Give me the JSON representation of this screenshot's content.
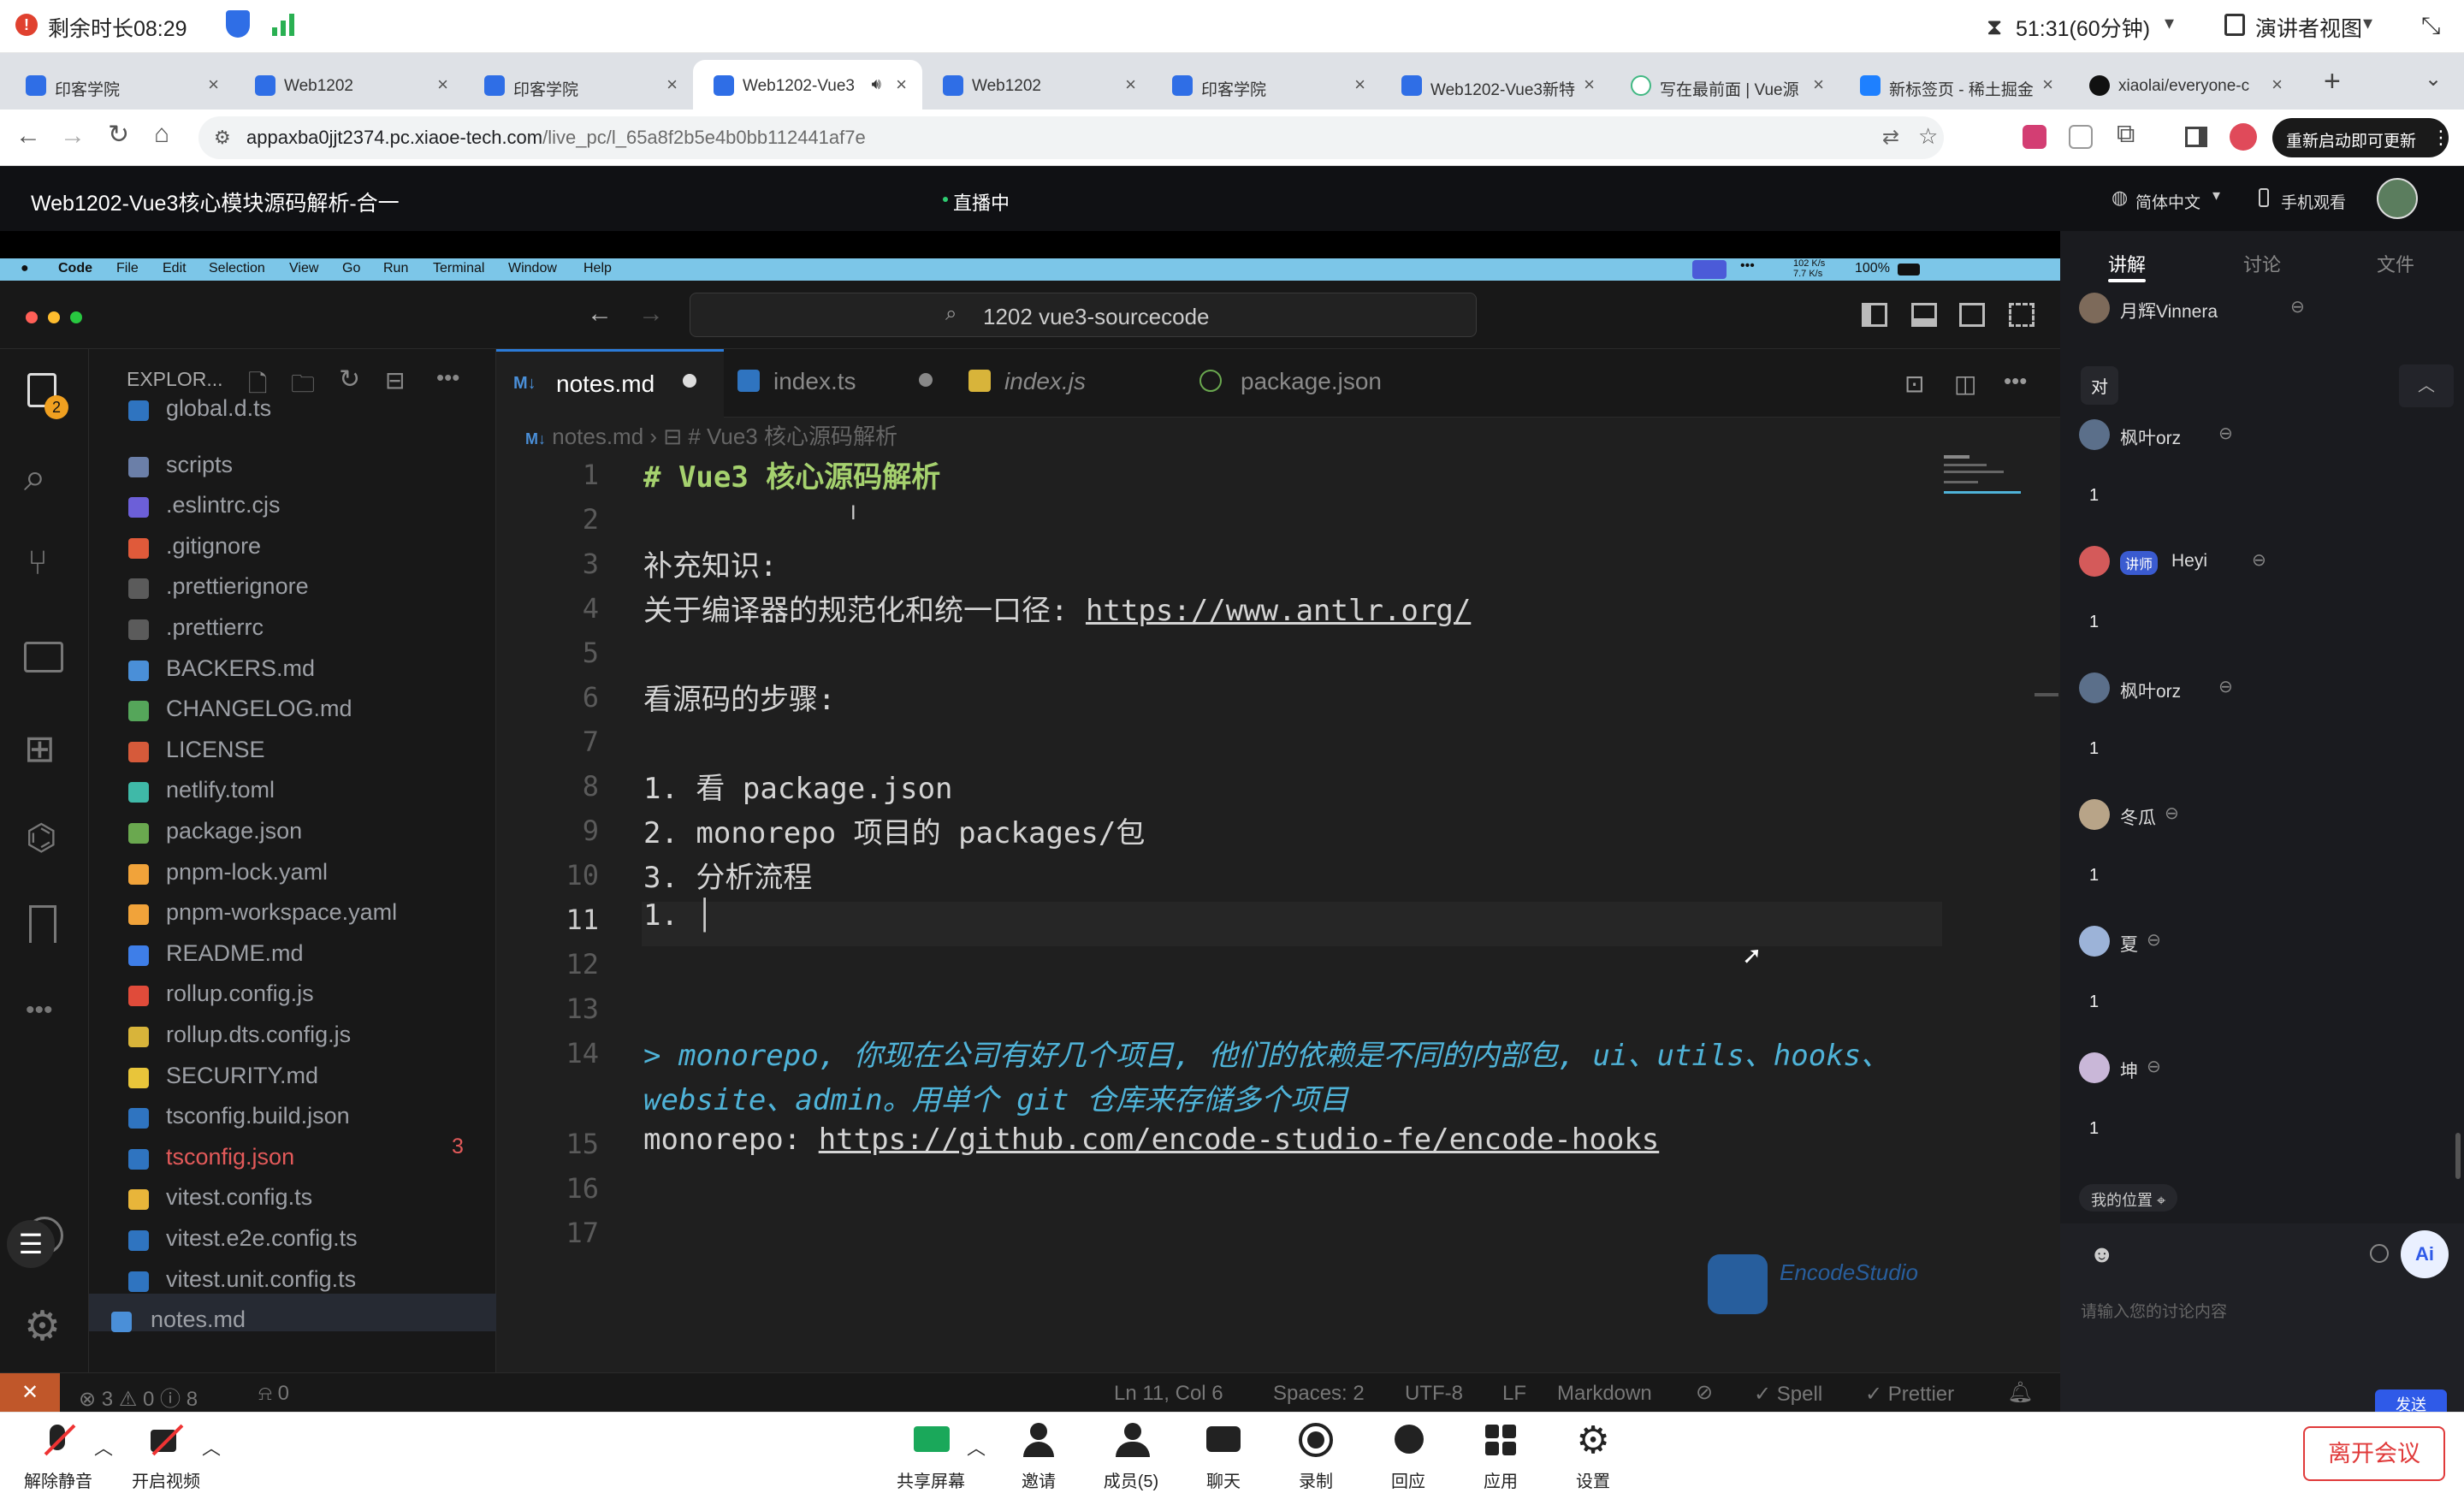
{
  "sysbar": {
    "timer_label": "剩余时长08:29",
    "duration": "51:31(60分钟)",
    "presenter_view": "演讲者视图"
  },
  "browser_tabs": [
    {
      "label": "印客学院",
      "active": false
    },
    {
      "label": "Web1202",
      "active": false
    },
    {
      "label": "印客学院",
      "active": false
    },
    {
      "label": "Web1202-Vue3",
      "active": true
    },
    {
      "label": "Web1202",
      "active": false
    },
    {
      "label": "印客学院",
      "active": false
    },
    {
      "label": "Web1202-Vue3新特",
      "active": false
    },
    {
      "label": "写在最前面 | Vue源",
      "active": false
    },
    {
      "label": "新标签页 - 稀土掘金",
      "active": false
    },
    {
      "label": "xiaolai/everyone-c",
      "active": false
    }
  ],
  "address": {
    "host": "appaxba0jjt2374.pc.xiaoe-tech.com",
    "path": "/live_pc/l_65a8f2b5e4b0bb112441af7e",
    "update_label": "重新启动即可更新"
  },
  "meeting": {
    "title": "Web1202-Vue3核心模块源码解析-合一",
    "status": "直播中",
    "language": "简体中文",
    "mobile": "手机观看"
  },
  "mac_menu": [
    "Code",
    "File",
    "Edit",
    "Selection",
    "View",
    "Go",
    "Run",
    "Terminal",
    "Window",
    "Help"
  ],
  "mac_status": {
    "net_up": "102 K/s",
    "net_down": "7.7 K/s",
    "battery": "100%"
  },
  "vscode": {
    "search": "1202 vue3-sourcecode",
    "explorer_title": "EXPLOR...",
    "activity_badge": "2",
    "files": [
      {
        "name": "global.d.ts",
        "color": "#9da0a6",
        "icon": "#2f74c0"
      },
      {
        "name": "scripts",
        "color": "#9da0a6",
        "icon": "#6b7fa8"
      },
      {
        "name": ".eslintrc.cjs",
        "color": "#9da0a6",
        "icon": "#6c5fd8"
      },
      {
        "name": ".gitignore",
        "color": "#9da0a6",
        "icon": "#e05a3a"
      },
      {
        "name": ".prettierignore",
        "color": "#9da0a6",
        "icon": "#5b5b5b"
      },
      {
        "name": ".prettierrc",
        "color": "#9da0a6",
        "icon": "#5b5b5b"
      },
      {
        "name": "BACKERS.md",
        "color": "#9da0a6",
        "icon": "#4a8fd8"
      },
      {
        "name": "CHANGELOG.md",
        "color": "#9da0a6",
        "icon": "#55a65a"
      },
      {
        "name": "LICENSE",
        "color": "#9da0a6",
        "icon": "#d65a3a"
      },
      {
        "name": "netlify.toml",
        "color": "#9da0a6",
        "icon": "#3fb9a8"
      },
      {
        "name": "package.json",
        "color": "#9da0a6",
        "icon": "#6aa84f"
      },
      {
        "name": "pnpm-lock.yaml",
        "color": "#9da0a6",
        "icon": "#f1a33a"
      },
      {
        "name": "pnpm-workspace.yaml",
        "color": "#9da0a6",
        "icon": "#f1a33a"
      },
      {
        "name": "README.md",
        "color": "#9da0a6",
        "icon": "#3e7ee8"
      },
      {
        "name": "rollup.config.js",
        "color": "#9da0a6",
        "icon": "#e04b3a"
      },
      {
        "name": "rollup.dts.config.js",
        "color": "#9da0a6",
        "icon": "#d8b43a"
      },
      {
        "name": "SECURITY.md",
        "color": "#9da0a6",
        "icon": "#e8c53a"
      },
      {
        "name": "tsconfig.build.json",
        "color": "#9da0a6",
        "icon": "#2f74c0"
      },
      {
        "name": "tsconfig.json",
        "color": "#e35a5a",
        "icon": "#2f74c0"
      },
      {
        "name": "vitest.config.ts",
        "color": "#9da0a6",
        "icon": "#e8b53a"
      },
      {
        "name": "vitest.e2e.config.ts",
        "color": "#9da0a6",
        "icon": "#2f74c0"
      },
      {
        "name": "vitest.unit.config.ts",
        "color": "#9da0a6",
        "icon": "#2f74c0"
      },
      {
        "name": "notes.md",
        "color": "#9da0a6",
        "icon": "#4a8fd8"
      }
    ],
    "tsconfig_errors": "3",
    "tabs": [
      "notes.md",
      "index.ts",
      "index.js",
      "package.json"
    ],
    "breadcrumb": [
      "notes.md",
      "# Vue3 核心源码解析"
    ],
    "lines": [
      {
        "n": "1",
        "text": "# Vue3 核心源码解析",
        "color": "#a5d16e"
      },
      {
        "n": "2",
        "text": "",
        "color": "#d4d4d4"
      },
      {
        "n": "3",
        "text": "补充知识:",
        "color": "#d4d4d4"
      },
      {
        "n": "4",
        "text": "关于编译器的规范化和统一口径: ",
        "color": "#d4d4d4",
        "link": "https://www.antlr.org/"
      },
      {
        "n": "5",
        "text": "",
        "color": "#d4d4d4"
      },
      {
        "n": "6",
        "text": "看源码的步骤:",
        "color": "#d4d4d4"
      },
      {
        "n": "7",
        "text": "",
        "color": "#d4d4d4"
      },
      {
        "n": "8",
        "text": "1. 看 package.json",
        "color": "#d4d4d4"
      },
      {
        "n": "9",
        "text": "2. monorepo 项目的 packages/包",
        "color": "#d4d4d4"
      },
      {
        "n": "10",
        "text": "3. 分析流程",
        "color": "#d4d4d4"
      },
      {
        "n": "11",
        "text": "  1. ",
        "color": "#d4d4d4"
      },
      {
        "n": "12",
        "text": "",
        "color": "#d4d4d4"
      },
      {
        "n": "13",
        "text": "",
        "color": "#d4d4d4"
      },
      {
        "n": "14",
        "text": "> monorepo, 你现在公司有好几个项目, 他们的依赖是不同的内部包, ui、utils、hooks、",
        "color": "#4fb3d8",
        "italic": true
      },
      {
        "n": "",
        "text": "website、admin。用单个 git 仓库来存储多个项目",
        "color": "#4fb3d8",
        "italic": true
      },
      {
        "n": "15",
        "text": "monorepo: ",
        "color": "#d4d4d4",
        "link": "https://github.com/encode-studio-fe/encode-hooks"
      },
      {
        "n": "16",
        "text": "",
        "color": "#d4d4d4"
      },
      {
        "n": "17",
        "text": "",
        "color": "#d4d4d4"
      }
    ],
    "watermark": "EncodeStudio",
    "status": {
      "errors": "3",
      "warnings": "0",
      "info": "8",
      "ports": "0",
      "position": "Ln 11, Col 6",
      "spaces": "Spaces: 2",
      "encoding": "UTF-8",
      "eol": "LF",
      "language": "Markdown",
      "spell": "Spell",
      "prettier": "Prettier"
    }
  },
  "chat": {
    "tabs": [
      "讲解",
      "讨论",
      "文件"
    ],
    "messages": [
      {
        "user": "月辉Vinnera",
        "text": "对"
      },
      {
        "user": "枫叶orz",
        "text": "1"
      },
      {
        "user": "Heyi",
        "badge": "讲师",
        "text": "1"
      },
      {
        "user": "枫叶orz",
        "text": "1"
      },
      {
        "user": "冬瓜",
        "text": "1"
      },
      {
        "user": "夏",
        "text": "1"
      },
      {
        "user": "坤",
        "text": "1"
      }
    ],
    "location": "我的位置",
    "input_placeholder": "请输入您的讨论内容",
    "send": "发送"
  },
  "toolbar": {
    "mute": "解除静音",
    "video": "开启视频",
    "share": "共享屏幕",
    "invite": "邀请",
    "members": "成员(5)",
    "chat": "聊天",
    "record": "录制",
    "reply": "回应",
    "apps": "应用",
    "settings": "设置",
    "leave": "离开会议"
  }
}
